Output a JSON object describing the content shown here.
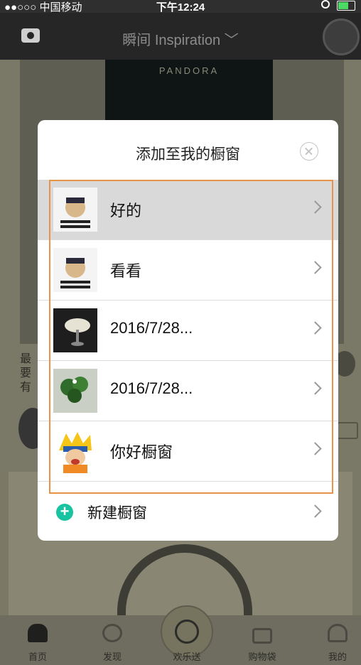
{
  "status_bar": {
    "carrier": "●●○○○ 中国移动",
    "time": "下午12:24"
  },
  "nav": {
    "title": "瞬间 Inspiration ﹀"
  },
  "background": {
    "side_text": "最要有",
    "banner_text": "PANDORA"
  },
  "dialog": {
    "title": "添加至我的橱窗",
    "items": [
      {
        "label": "好的",
        "selected": true
      },
      {
        "label": "看看",
        "selected": false
      },
      {
        "label": "2016/7/28...",
        "selected": false
      },
      {
        "label": "2016/7/28...",
        "selected": false
      },
      {
        "label": "你好橱窗",
        "selected": false
      }
    ],
    "new_window_label": "新建橱窗"
  },
  "tabbar": {
    "items": [
      {
        "label": "首页"
      },
      {
        "label": "发现"
      },
      {
        "label": "欢乐送"
      },
      {
        "label": "购物袋"
      },
      {
        "label": "我的"
      }
    ]
  },
  "colors": {
    "accent": "#17c3a0",
    "highlight_box": "#e8924a",
    "selected_row": "#d9d9d9"
  }
}
